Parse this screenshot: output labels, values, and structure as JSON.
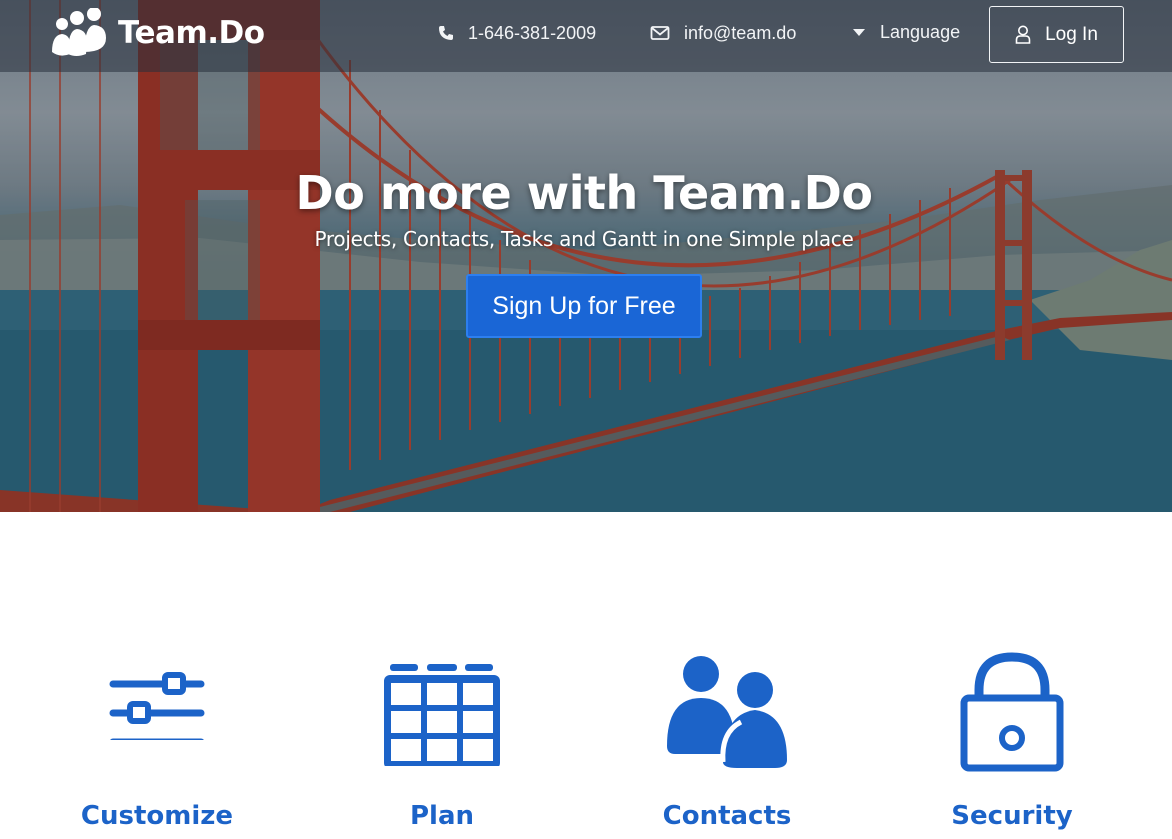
{
  "brand": {
    "name": "Team.Do"
  },
  "nav": {
    "phone": "1-646-381-2009",
    "email": "info@team.do",
    "language": "Language",
    "login": "Log In"
  },
  "hero": {
    "title": "Do more with Team.Do",
    "subtitle": "Projects, Contacts, Tasks and Gantt in one Simple place",
    "cta": "Sign Up for Free"
  },
  "features": [
    {
      "label": "Customize",
      "icon": "sliders-icon"
    },
    {
      "label": "Plan",
      "icon": "calendar-grid-icon"
    },
    {
      "label": "Contacts",
      "icon": "users-icon"
    },
    {
      "label": "Security",
      "icon": "lock-icon"
    }
  ],
  "colors": {
    "accent": "#1a66d6",
    "feature_blue": "#1c63c8"
  }
}
